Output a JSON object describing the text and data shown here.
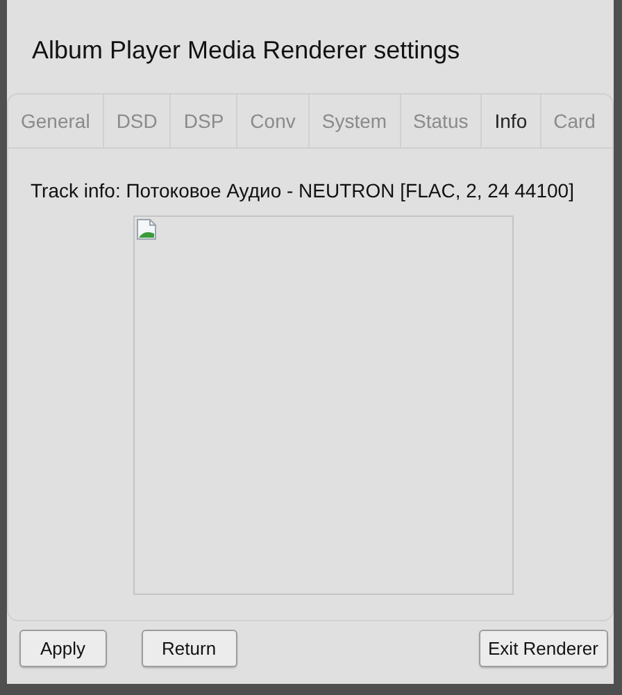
{
  "window": {
    "title": "Album Player Media Renderer settings"
  },
  "tabs": [
    {
      "label": "General",
      "selected": false
    },
    {
      "label": "DSD",
      "selected": false
    },
    {
      "label": "DSP",
      "selected": false
    },
    {
      "label": "Conv",
      "selected": false
    },
    {
      "label": "System",
      "selected": false
    },
    {
      "label": "Status",
      "selected": false
    },
    {
      "label": "Info",
      "selected": true
    },
    {
      "label": "Card",
      "selected": false
    }
  ],
  "track_info": "Track info: Потоковое Аудио - NEUTRON [FLAC, 2, 24 44100]",
  "buttons": [
    "Apply",
    "Return",
    "Exit Renderer"
  ]
}
